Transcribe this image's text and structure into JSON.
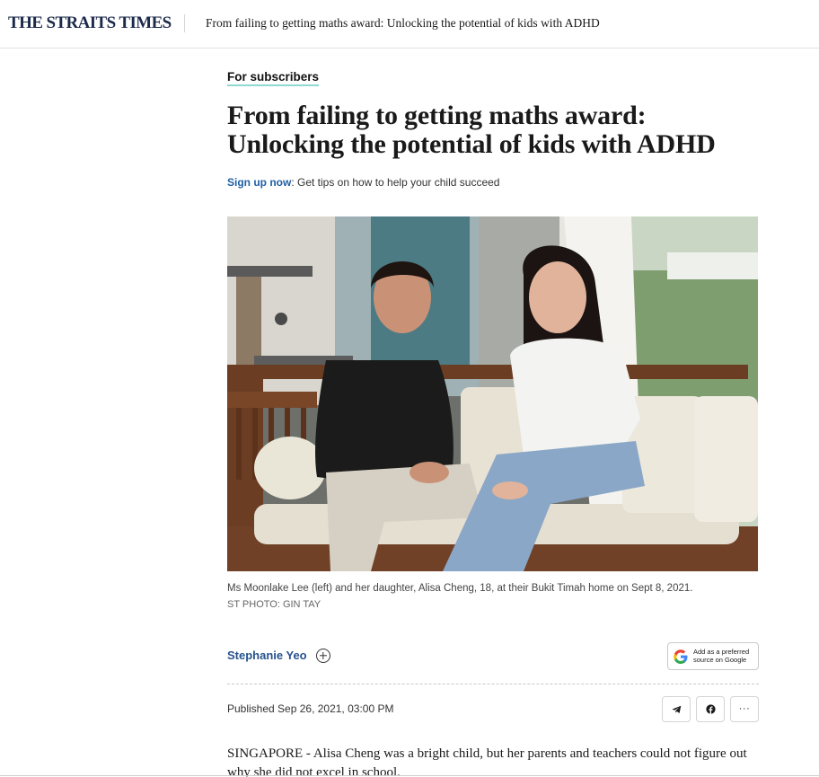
{
  "header": {
    "logo": "THE STRAITS TIMES",
    "article_title": "From failing to getting maths award: Unlocking the potential of kids with ADHD"
  },
  "article": {
    "label": "For subscribers",
    "headline": "From failing to getting maths award: Unlocking the potential of kids with ADHD",
    "signup_link": "Sign up now",
    "signup_text": ": Get tips on how to help your child succeed",
    "photo_caption": "Ms Moonlake Lee (left) and her daughter, Alisa Cheng, 18, at their Bukit Timah home on Sept 8, 2021.",
    "photo_credit": "ST PHOTO: GIN TAY",
    "author": "Stephanie Yeo",
    "google_button": "Add as a preferred source on Google",
    "published": "Published Sep 26, 2021, 03:00 PM",
    "more_label": "···",
    "body": "SINGAPORE - Alisa Cheng was a bright child, but her parents and teachers could not figure out why she did not excel in school."
  },
  "icons": {
    "follow": "plus-circle-icon",
    "telegram": "telegram-icon",
    "facebook": "facebook-icon",
    "more": "more-icon",
    "google": "google-g-icon"
  },
  "colors": {
    "brand": "#1b2a4a",
    "link": "#1f5fa6",
    "author": "#27528e",
    "subscriber_underline": "#8fd9cf"
  }
}
